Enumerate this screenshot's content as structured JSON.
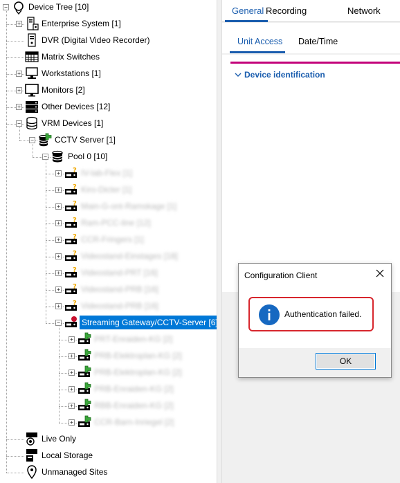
{
  "tree": {
    "items": [
      {
        "label": "Device Tree [10]",
        "icon": "location-pin-icon",
        "blurred": false
      },
      {
        "label": "Enterprise System [1]",
        "icon": "server-icon",
        "blurred": false
      },
      {
        "label": "DVR (Digital Video Recorder)",
        "icon": "dvr-icon",
        "blurred": false
      },
      {
        "label": "Matrix Switches",
        "icon": "matrix-switch-icon",
        "blurred": false
      },
      {
        "label": "Workstations [1]",
        "icon": "workstation-icon",
        "blurred": false
      },
      {
        "label": "Monitors [2]",
        "icon": "monitor-icon",
        "blurred": false
      },
      {
        "label": "Other Devices [12]",
        "icon": "other-devices-icon",
        "blurred": false
      },
      {
        "label": "VRM Devices [1]",
        "icon": "database-icon",
        "blurred": false
      },
      {
        "label": "CCTV Server [1]",
        "icon": "database-ok-icon",
        "blurred": false
      },
      {
        "label": "Pool 0 [10]",
        "icon": "pool-icon",
        "blurred": false
      },
      {
        "label": "IV-lab-Flex [1]",
        "icon": "encoder-warning-icon",
        "blurred": true
      },
      {
        "label": "Kiro-Dicter [1]",
        "icon": "encoder-warning-icon",
        "blurred": true
      },
      {
        "label": "Main-G-ont-Ramskage [1]",
        "icon": "encoder-warning-icon",
        "blurred": true
      },
      {
        "label": "Ram-PCC-line [12]",
        "icon": "encoder-warning-icon",
        "blurred": true
      },
      {
        "label": "CCR-Fringers [1]",
        "icon": "encoder-warning-icon",
        "blurred": true
      },
      {
        "label": "Videostand-Einstages [18]",
        "icon": "encoder-warning-icon",
        "blurred": true
      },
      {
        "label": "Videostand-PRT [16]",
        "icon": "encoder-warning-icon",
        "blurred": true
      },
      {
        "label": "Videostand-PRB [16]",
        "icon": "encoder-warning-icon",
        "blurred": true
      },
      {
        "label": "Videostand-PRB [16]",
        "icon": "encoder-warning-icon",
        "blurred": true
      },
      {
        "label": "Streaming Gateway/CCTV-Server [6]",
        "icon": "gateway-error-icon",
        "blurred": false
      },
      {
        "label": "PRT-Enraiden-KG [2]",
        "icon": "encoder-ok-icon",
        "blurred": true
      },
      {
        "label": "PRB-Elektroplan-KG [2]",
        "icon": "encoder-ok-icon",
        "blurred": true
      },
      {
        "label": "PRB-Elektroplan-KG [2]",
        "icon": "encoder-ok-icon",
        "blurred": true
      },
      {
        "label": "PRB-Enraiden-KG [2]",
        "icon": "encoder-ok-icon",
        "blurred": true
      },
      {
        "label": "RBB-Enraiden-KG [2]",
        "icon": "encoder-ok-icon",
        "blurred": true
      },
      {
        "label": "CCR-Barn-Inriegel [2]",
        "icon": "encoder-ok-icon",
        "blurred": true
      },
      {
        "label": "Live Only",
        "icon": "live-only-icon",
        "blurred": false
      },
      {
        "label": "Local Storage",
        "icon": "local-storage-icon",
        "blurred": false
      },
      {
        "label": "Unmanaged Sites",
        "icon": "unmanaged-sites-icon",
        "blurred": false
      }
    ]
  },
  "tabs": {
    "top": [
      "General",
      "Recording",
      "Network"
    ],
    "top_active": "General",
    "sub": [
      "Unit Access",
      "Date/Time"
    ],
    "sub_active": "Unit Access"
  },
  "content": {
    "section_header": "Device identification"
  },
  "dialog": {
    "title": "Configuration Client",
    "message": "Authentication failed.",
    "ok_label": "OK"
  },
  "colors": {
    "accent": "#1a5dae",
    "selection": "#0078d7",
    "highlight_border": "#d7262d",
    "magenta_line": "#c3007a",
    "status_green": "#3aa53a",
    "status_warning": "#f0a800",
    "status_error": "#c8102e"
  }
}
